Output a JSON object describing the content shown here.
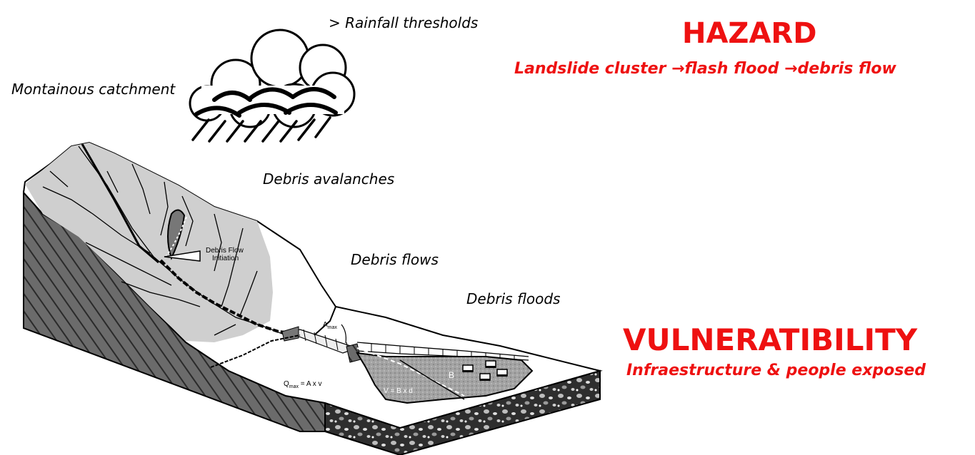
{
  "labels": {
    "rainfall": "> Rainfall thresholds",
    "catchment": "Montainous catchment",
    "avalanches": "Debris avalanches",
    "flows": "Debris flows",
    "floods": "Debris floods"
  },
  "hazard": {
    "title": "HAZARD",
    "chain_part1": "Landslide cluster",
    "chain_part2": "flash flood",
    "chain_part3": "debris flow",
    "arrow": "→"
  },
  "vulnerability": {
    "title": "VULNERATIBILITY",
    "subtitle": "Infraestructure & people exposed"
  },
  "figure": {
    "initiation_line1": "Debris Flow",
    "initiation_line2": "Initiation",
    "amax": "A",
    "amax_sub": "max",
    "qmax_q": "Q",
    "qmax_sub": "max",
    "qmax_rest": " = A x v",
    "volume": "V = B x d",
    "b_label": "B"
  },
  "colors": {
    "accent_red": "#ee1111",
    "slope_gray": "#cfcfcf",
    "fan_gray": "#9a9a9a",
    "cross_section": "#5a5a5a"
  },
  "icons": [
    "cloud-icon",
    "rain-icon"
  ]
}
